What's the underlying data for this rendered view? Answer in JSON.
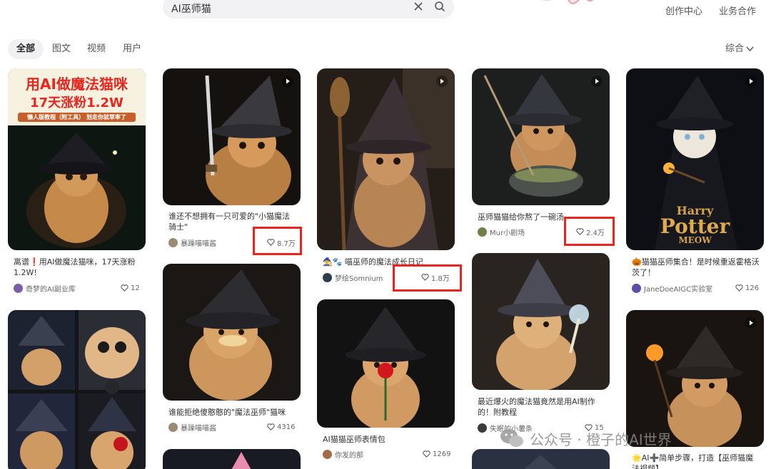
{
  "search": {
    "query": "AI巫师猫"
  },
  "header": {
    "links": [
      "创作中心",
      "业务合作"
    ]
  },
  "tabs": [
    {
      "label": "全部",
      "active": true
    },
    {
      "label": "图文",
      "active": false
    },
    {
      "label": "视频",
      "active": false
    },
    {
      "label": "用户",
      "active": false
    }
  ],
  "sort": {
    "label": "综合"
  },
  "colors": {
    "highlight": "#e8261f",
    "tab_active_bg": "#f1f1f3",
    "search_bg": "#f2f2f4"
  },
  "cards": [
    {
      "thumb_text": {
        "line1": "用AI做魔法猫咪",
        "line2": "17天涨粉1.2W",
        "line3": "懒人版教程（附工具） 划走你就草率了"
      },
      "title": "离谱❗️用AI做魔法猫咪，17天涨粉1.2W!",
      "author": "奇梦的AI副业库",
      "likes": "12"
    },
    {
      "title": ""
    },
    {
      "title": "谁还不想拥有一只可爱的\"小猫魔法骑士\"",
      "author": "暴躁喵喵酱",
      "likes": "8.7万"
    },
    {
      "title": "谁能拒绝傻憨憨的\"魔法巫师\"猫咪",
      "author": "暴躁喵喵酱",
      "likes": "4316"
    },
    {
      "title": ""
    },
    {
      "title": "🧙‍♀️🐾 喵巫师的魔法成长日记",
      "author": "梦绘Somnium",
      "likes": "1.8万"
    },
    {
      "title": "AI猫猫巫师表情包",
      "author": "你发的那",
      "likes": "1269"
    },
    {
      "title": "巫师猫猫给你熬了一碗汤",
      "author": "Mur小剧场",
      "likes": "2.4万"
    },
    {
      "title": "最近爆火的魔法猫竟然是用AI制作的！附教程",
      "author": "失眠的小薯条",
      "likes": "15"
    },
    {
      "thumb_text": {
        "line1": "Harry",
        "line2": "Potter",
        "line3": "MEOW"
      },
      "title": "🎃猫猫巫师集合！是时候重返霍格沃茨了！",
      "author": "JaneDoeAIGC实验室",
      "likes": "126"
    },
    {
      "title": "🌟AI➕简单步骤，打造【巫师猫魔法视频】",
      "author": "",
      "likes": ""
    }
  ],
  "watermark": {
    "text": "公众号 · 橙子的AI世界"
  }
}
